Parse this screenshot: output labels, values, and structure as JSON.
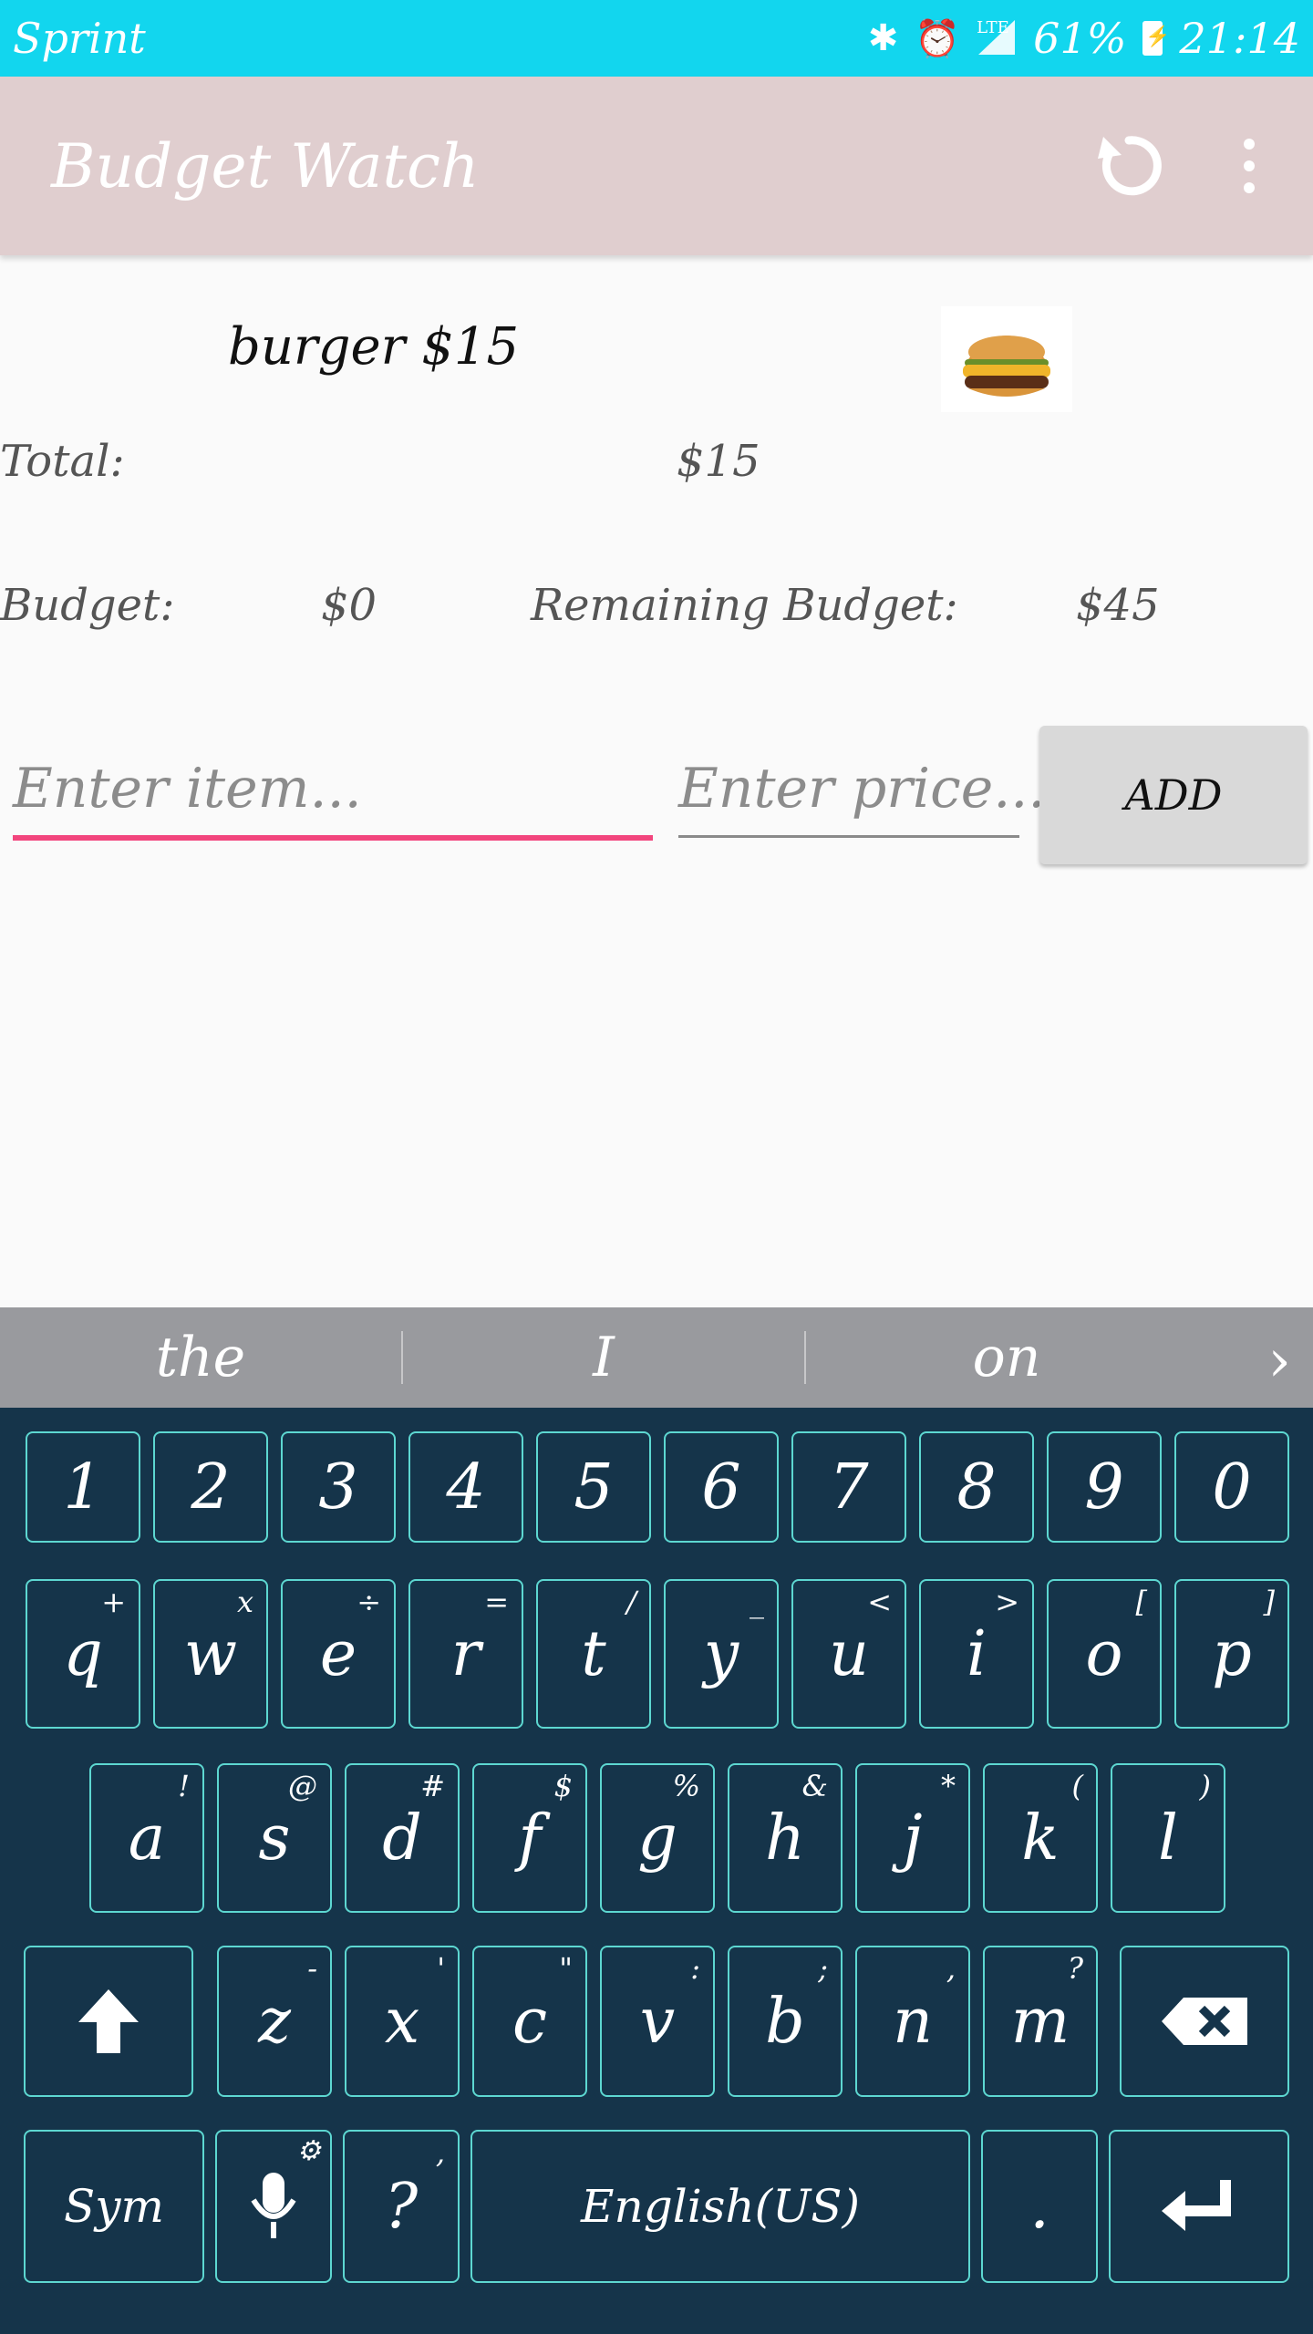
{
  "status_bar": {
    "carrier": "Sprint",
    "bluetooth_icon": "bluetooth-icon",
    "alarm_icon": "alarm-icon",
    "network": "LTE",
    "battery_percent": "61%",
    "time": "21:14"
  },
  "app_bar": {
    "title": "Budget Watch",
    "refresh_icon": "refresh-icon",
    "menu_icon": "overflow-menu-icon"
  },
  "expense": {
    "text": "burger $15",
    "image": "burger-image"
  },
  "total": {
    "label": "Total:",
    "value": "$15"
  },
  "budget": {
    "label": "Budget:",
    "value": "$0",
    "remaining_label": "Remaining Budget:",
    "remaining_value": "$45"
  },
  "form": {
    "item_placeholder": "Enter item...",
    "price_placeholder": "Enter price...",
    "add_label": "ADD"
  },
  "suggestions": [
    "the",
    "I",
    "on"
  ],
  "keyboard": {
    "number_row": [
      "1",
      "2",
      "3",
      "4",
      "5",
      "6",
      "7",
      "8",
      "9",
      "0"
    ],
    "row1": [
      {
        "k": "q",
        "s": "+"
      },
      {
        "k": "w",
        "s": "x"
      },
      {
        "k": "e",
        "s": "÷"
      },
      {
        "k": "r",
        "s": "="
      },
      {
        "k": "t",
        "s": "/"
      },
      {
        "k": "y",
        "s": "_"
      },
      {
        "k": "u",
        "s": "<"
      },
      {
        "k": "i",
        "s": ">"
      },
      {
        "k": "o",
        "s": "["
      },
      {
        "k": "p",
        "s": "]"
      }
    ],
    "row2": [
      {
        "k": "a",
        "s": "!"
      },
      {
        "k": "s",
        "s": "@"
      },
      {
        "k": "d",
        "s": "#"
      },
      {
        "k": "f",
        "s": "$"
      },
      {
        "k": "g",
        "s": "%"
      },
      {
        "k": "h",
        "s": "&"
      },
      {
        "k": "j",
        "s": "*"
      },
      {
        "k": "k",
        "s": "("
      },
      {
        "k": "l",
        "s": ")"
      }
    ],
    "row3": [
      {
        "k": "z",
        "s": "-"
      },
      {
        "k": "x",
        "s": "'"
      },
      {
        "k": "c",
        "s": "\""
      },
      {
        "k": "v",
        "s": ":"
      },
      {
        "k": "b",
        "s": ";"
      },
      {
        "k": "n",
        "s": ","
      },
      {
        "k": "m",
        "s": "?"
      }
    ],
    "sym_label": "Sym",
    "question_label": "?",
    "question_sub": ",",
    "space_label": "English(US)",
    "period_label": "."
  },
  "colors": {
    "status_bar": "#12d6ee",
    "app_bar": "#e0cecf",
    "accent": "#f2457d",
    "keyboard_bg": "#15344a",
    "key_border": "#5dd7d1"
  }
}
